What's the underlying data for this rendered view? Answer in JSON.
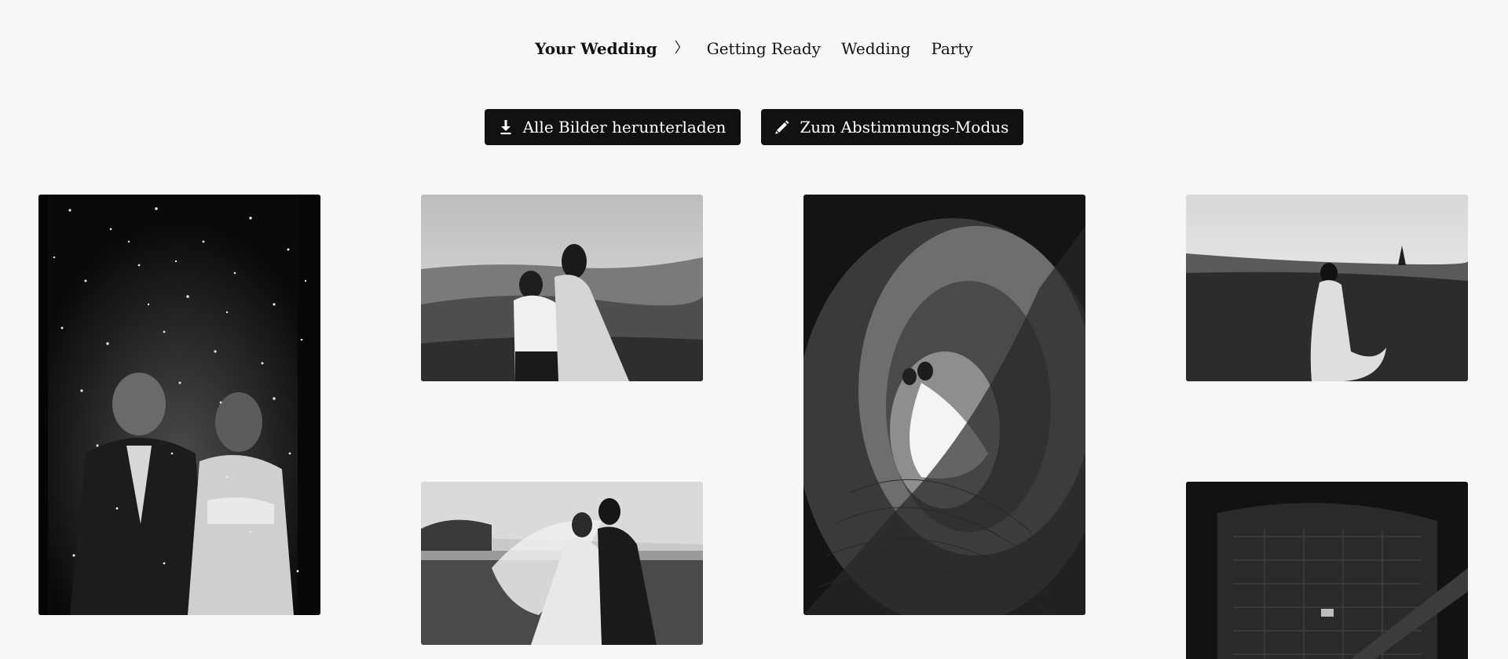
{
  "nav": {
    "root_label": "Your Wedding",
    "separator": "〉",
    "items": [
      {
        "label": "Getting Ready"
      },
      {
        "label": "Wedding"
      },
      {
        "label": "Party"
      }
    ]
  },
  "actions": {
    "download_label": "Alle Bilder herunterladen",
    "vote_label": "Zum Abstimmungs-Modus"
  },
  "icons": {
    "download": "download-icon",
    "vote": "pencil-icon"
  },
  "colors": {
    "background": "#f7f7f7",
    "button": "#111111",
    "button_text": "#ffffff"
  }
}
